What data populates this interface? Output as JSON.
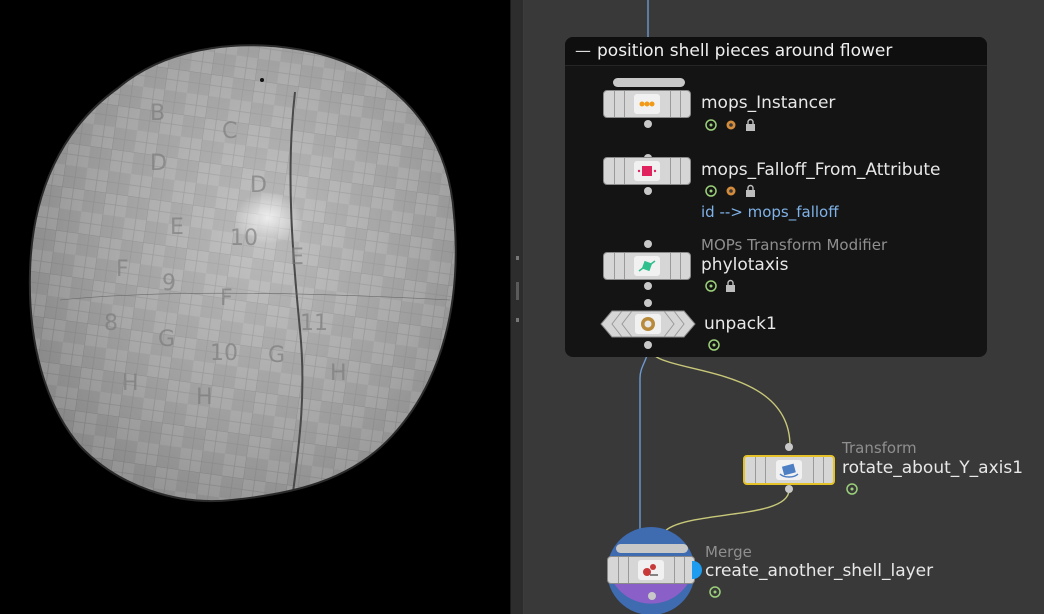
{
  "network_box": {
    "title": "position shell pieces around flower",
    "collapse_glyph": "—"
  },
  "nodes": [
    {
      "name": "mops_Instancer",
      "icon": "orange-dots-icon",
      "flags": [
        "display-flag-icon",
        "cook-icon",
        "lock-icon"
      ]
    },
    {
      "name": "mops_Falloff_From_Attribute",
      "icon": "pink-diamond-icon",
      "label": "id --> mops_falloff",
      "flags": [
        "display-flag-icon",
        "cook-icon",
        "lock-icon"
      ]
    },
    {
      "type": "MOPs Transform Modifier",
      "name": "phylotaxis",
      "icon": "green-arrow-icon",
      "flags": [
        "display-flag-icon",
        "lock-icon"
      ]
    },
    {
      "name": "unpack1",
      "icon": "unpack-icon",
      "flags": [
        "display-flag-icon"
      ]
    },
    {
      "type": "Transform",
      "name": "rotate_about_Y_axis1",
      "icon": "transform-icon",
      "flags": [
        "display-flag-icon"
      ]
    },
    {
      "type": "Merge",
      "name": "create_another_shell_layer",
      "icon": "merge-icon",
      "flags": [
        "display-flag-icon"
      ]
    }
  ],
  "colors": {
    "network_bg": "#393939",
    "netbox_bg": "#141414",
    "wire_blue": "#6e9ad0",
    "wire_yellow": "#c8c87a",
    "selected_outline": "#e6c229",
    "attr_label": "#7fb2e8",
    "flag_green": "#9bd07a",
    "merge_ring": "#3f6bb0"
  }
}
